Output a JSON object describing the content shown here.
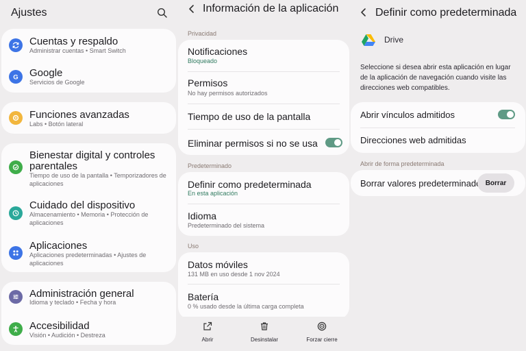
{
  "colors": {
    "background": "#efedee",
    "card": "#fcfbfc",
    "toggle_on": "#5f9a85",
    "accent_text": "#2f7a5f"
  },
  "settings": {
    "title": "Ajustes",
    "search_icon": "search-icon",
    "items": [
      {
        "title": "Cuentas y respaldo",
        "subtitle": "Administrar cuentas  •  Smart Switch",
        "icon": "sync-icon",
        "color": "#3d74e6"
      },
      {
        "title": "Google",
        "subtitle": "Servicios de Google",
        "icon": "google-icon",
        "color": "#3d74e6"
      },
      {
        "title": "Funciones avanzadas",
        "subtitle": "Labs  •  Botón lateral",
        "icon": "gear-plus-icon",
        "color": "#f2b63d"
      },
      {
        "title": "Bienestar digital y controles",
        "title2": "parentales",
        "subtitle": "Tiempo de uso de la pantalla  •  Temporizadores de",
        "subtitle2": "aplicaciones",
        "icon": "wellbeing-icon",
        "color": "#3fad4a"
      },
      {
        "title": "Cuidado del dispositivo",
        "subtitle": "Almacenamiento  •  Memoria  •  Protección de",
        "subtitle2": "aplicaciones",
        "icon": "device-care-icon",
        "color": "#2aa89a"
      },
      {
        "title": "Aplicaciones",
        "subtitle": "Aplicaciones predeterminadas  •  Ajustes de",
        "subtitle2": "aplicaciones",
        "icon": "apps-grid-icon",
        "color": "#3d74e6"
      },
      {
        "title": "Administración general",
        "subtitle": "Idioma y teclado  •  Fecha y hora",
        "icon": "sliders-icon",
        "color": "#6c6aa6"
      },
      {
        "title": "Accesibilidad",
        "subtitle": "Visión  •  Audición  •  Destreza",
        "icon": "accessibility-icon",
        "color": "#3fad4a"
      }
    ]
  },
  "appinfo": {
    "title": "Información de la aplicación",
    "back_icon": "back-arrow-icon",
    "section_privacy": "Privacidad",
    "notifications_title": "Notificaciones",
    "notifications_value": "Bloqueado",
    "permissions_title": "Permisos",
    "permissions_value": "No hay permisos autorizados",
    "screen_time_title": "Tiempo de uso de la pantalla",
    "remove_permissions_title": "Eliminar permisos si no se usa",
    "remove_permissions_on": true,
    "section_default": "Predeterminado",
    "set_default_title": "Definir como predeterminada",
    "set_default_value": "En esta aplicación",
    "language_title": "Idioma",
    "language_value": "Predeterminado del sistema",
    "section_usage": "Uso",
    "mobile_data_title": "Datos móviles",
    "mobile_data_value": "131 MB en uso desde 1 nov 2024",
    "battery_title": "Batería",
    "battery_value": "0 % usado desde la última carga completa",
    "bottom": {
      "open_label": "Abrir",
      "uninstall_label": "Desinstalar",
      "force_stop_label": "Forzar cierre"
    }
  },
  "setdefault": {
    "title": "Definir como predeterminada",
    "back_icon": "back-arrow-icon",
    "app_name": "Drive",
    "app_icon": "drive-icon",
    "description": "Seleccione si desea abrir esta aplicación en lugar de la aplicación de navegación cuando visite las direcciones web compatibles.",
    "open_links_title": "Abrir vínculos admitidos",
    "open_links_on": true,
    "web_addresses_title": "Direcciones web admitidas",
    "section_open_default": "Abrir de forma predeterminada",
    "clear_defaults_title": "Borrar valores predeterminados",
    "clear_button": "Borrar"
  }
}
